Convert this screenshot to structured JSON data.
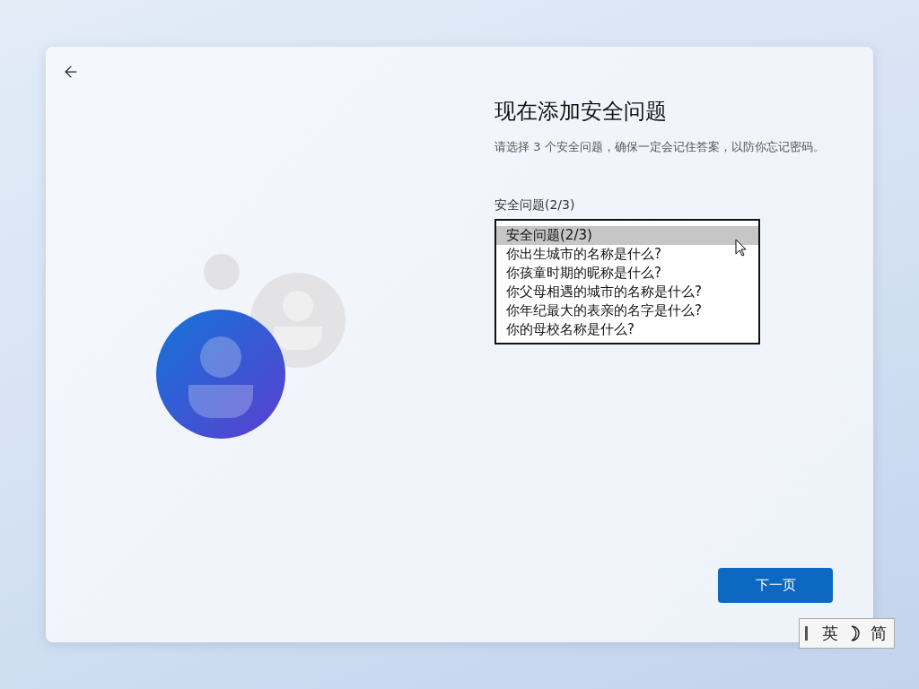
{
  "title": "现在添加安全问题",
  "description": "请选择 3 个安全问题，确保一定会记住答案，以防你忘记密码。",
  "field_label": "安全问题(2/3)",
  "dropdown": {
    "options": [
      {
        "label": "安全问题(2/3)",
        "selected": true
      },
      {
        "label": "你出生城市的名称是什么?",
        "selected": false
      },
      {
        "label": "你孩童时期的昵称是什么?",
        "selected": false
      },
      {
        "label": "你父母相遇的城市的名称是什么?",
        "selected": false
      },
      {
        "label": "你年纪最大的表亲的名字是什么?",
        "selected": false
      },
      {
        "label": "你的母校名称是什么?",
        "selected": false
      }
    ]
  },
  "next_button": {
    "label": "下一页"
  },
  "ime_bar": {
    "input_mode": "英",
    "script": "简"
  }
}
